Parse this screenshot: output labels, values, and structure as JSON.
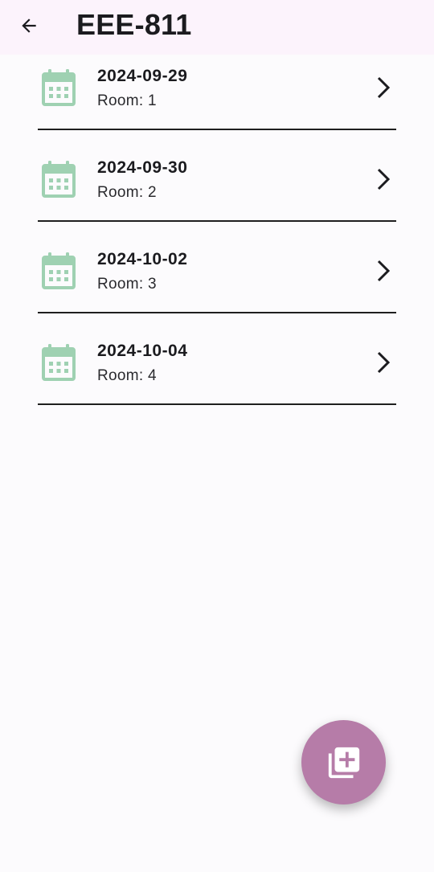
{
  "header": {
    "title": "EEE-811",
    "back_icon": "arrow-left-icon"
  },
  "sessions": [
    {
      "date": "2024-09-29",
      "room": "Room: 1"
    },
    {
      "date": "2024-09-30",
      "room": "Room: 2"
    },
    {
      "date": "2024-10-02",
      "room": "Room: 3"
    },
    {
      "date": "2024-10-04",
      "room": "Room: 4"
    }
  ],
  "icons": {
    "item_icon": "calendar-icon",
    "item_trailing": "chevron-right-icon",
    "fab_icon": "library-add-icon"
  },
  "colors": {
    "app_bar": "#fcf3fc",
    "calendar_icon": "#9fd1b2",
    "fab": "#b67ca8",
    "divider": "#1f1f1f"
  }
}
